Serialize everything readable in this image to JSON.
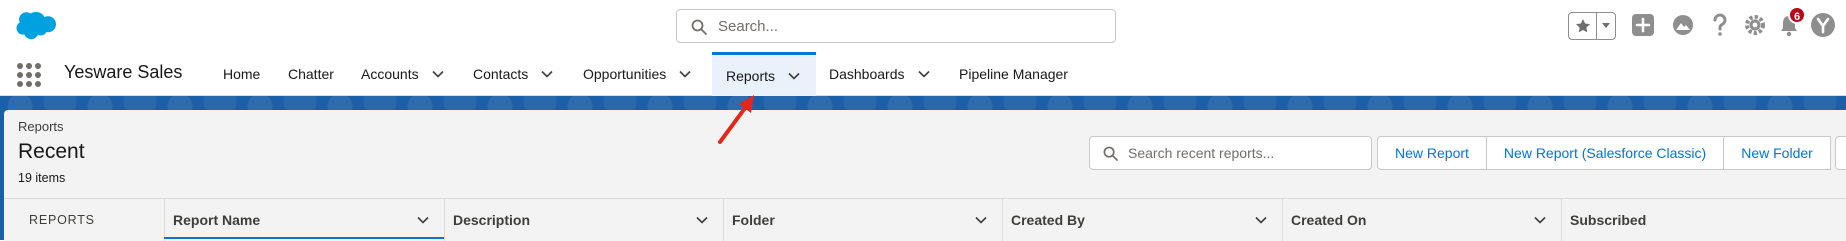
{
  "global_header": {
    "search_placeholder": "Search...",
    "notification_count": "6"
  },
  "nav": {
    "app_name": "Yesware Sales",
    "items": [
      {
        "label": "Home"
      },
      {
        "label": "Chatter"
      },
      {
        "label": "Accounts"
      },
      {
        "label": "Contacts"
      },
      {
        "label": "Opportunities"
      },
      {
        "label": "Reports"
      },
      {
        "label": "Dashboards"
      },
      {
        "label": "Pipeline Manager"
      }
    ],
    "active": "Reports"
  },
  "page": {
    "breadcrumb": "Reports",
    "title": "Recent",
    "count": "19 items",
    "search_placeholder": "Search recent reports...",
    "buttons": [
      "New Report",
      "New Report (Salesforce Classic)",
      "New Folder"
    ]
  },
  "table": {
    "side_label": "REPORTS",
    "columns": [
      "Report Name",
      "Description",
      "Folder",
      "Created By",
      "Created On",
      "Subscribed"
    ]
  },
  "colors": {
    "brand": "#0176d3",
    "banner": "#1b5fa8",
    "badge": "#ba0517",
    "annotation": "#e8251b"
  }
}
